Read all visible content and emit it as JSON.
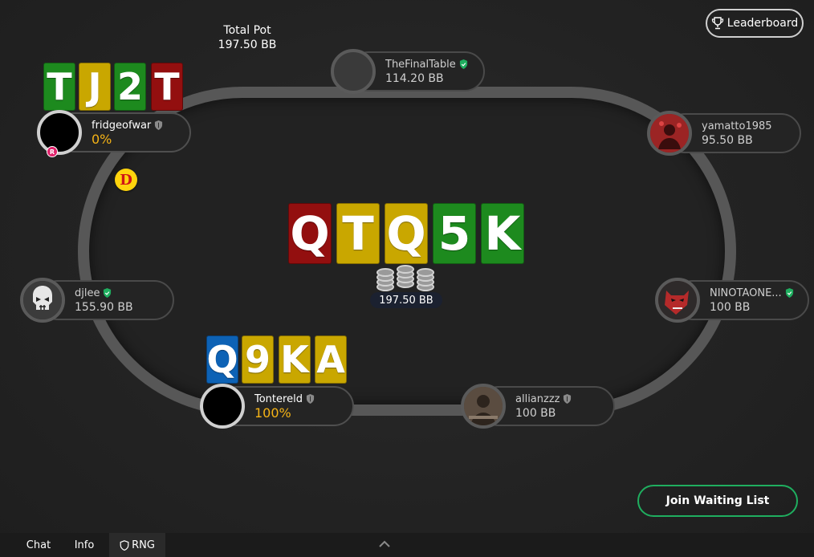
{
  "pot": {
    "total_label": "Total Pot",
    "total_value": "197.50 BB",
    "center_value": "197.50 BB"
  },
  "header": {
    "leaderboard_label": "Leaderboard"
  },
  "board": [
    "Q",
    "T",
    "Q",
    "5",
    "K"
  ],
  "dealer": "D",
  "players": {
    "fridgeofwar": {
      "name": "fridgeofwar",
      "stack": "0%",
      "cards": [
        "T",
        "J",
        "2",
        "T"
      ],
      "badge": "R"
    },
    "thefinaltable": {
      "name": "TheFinalTable",
      "stack": "114.20 BB"
    },
    "yamatto": {
      "name": "yamatto1985",
      "stack": "95.50 BB"
    },
    "djlee": {
      "name": "djlee",
      "stack": "155.90 BB"
    },
    "ninotaone": {
      "name": "NINOTAONE...",
      "stack": "100 BB"
    },
    "tontereld": {
      "name": "Tontereld",
      "stack": "100%",
      "cards": [
        "Q",
        "9",
        "K",
        "A"
      ]
    },
    "allianzzz": {
      "name": "allianzzz",
      "stack": "100 BB"
    }
  },
  "actions": {
    "join_waiting_list": "Join Waiting List"
  },
  "footer": {
    "chat": "Chat",
    "info": "Info",
    "rng": "RNG"
  },
  "colors": {
    "green": "#1d8a1e",
    "yellow": "#c9a700",
    "red": "#930f0f",
    "blue": "#0d62b5",
    "accent": "#1fae5f",
    "stack_highlight": "#f5b316"
  }
}
